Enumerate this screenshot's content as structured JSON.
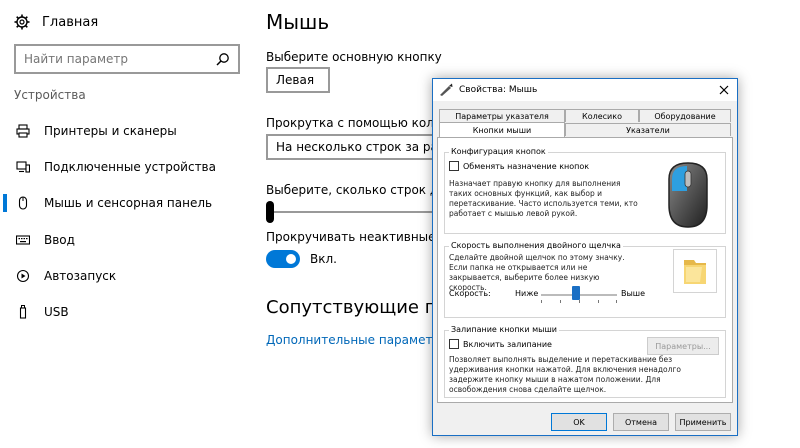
{
  "sidebar": {
    "home_label": "Главная",
    "search_placeholder": "Найти параметр",
    "section_title": "Устройства",
    "items": [
      {
        "label": "Принтеры и сканеры",
        "icon": "printer-icon"
      },
      {
        "label": "Подключенные устройства",
        "icon": "devices-icon"
      },
      {
        "label": "Мышь и сенсорная панель",
        "icon": "mouse-icon"
      },
      {
        "label": "Ввод",
        "icon": "keyboard-icon"
      },
      {
        "label": "Автозапуск",
        "icon": "autoplay-icon"
      },
      {
        "label": "USB",
        "icon": "usb-icon"
      }
    ],
    "active_item": "Мышь и сенсорная панель"
  },
  "main": {
    "title": "Мышь",
    "primary_button_label": "Выберите основную кнопку",
    "primary_button_value": "Левая",
    "scroll_label": "Прокрутка с помощью колесика",
    "scroll_value": "На несколько строк за раз",
    "lines_label": "Выберите, сколько строк должно",
    "inactive_scroll_label": "Прокручивать неактивные окна",
    "inactive_scroll_value": "Вкл.",
    "related_title": "Сопутствующие параметры",
    "related_link": "Дополнительные параметры мыши"
  },
  "dialog": {
    "title": "Свойства: Мышь",
    "tabs_back": [
      "Параметры указателя",
      "Колесико",
      "Оборудование"
    ],
    "tabs_front": [
      "Кнопки мыши",
      "Указатели"
    ],
    "active_tab": "Кнопки мыши",
    "button_config": {
      "title": "Конфигурация кнопок",
      "checkbox": "Обменять назначение кнопок",
      "description": "Назначает правую кнопку для выполнения таких основных функций, как выбор и перетаскивание. Часто используется теми, кто работает с мышью левой рукой."
    },
    "double_click": {
      "title": "Скорость выполнения двойного щелчка",
      "description": "Сделайте двойной щелчок по этому значку. Если папка не открывается или не закрывается, выберите более низкую скорость.",
      "speed_label": "Скорость:",
      "slow_label": "Ниже",
      "fast_label": "Выше"
    },
    "click_lock": {
      "title": "Залипание кнопки мыши",
      "checkbox": "Включить залипание",
      "settings_button": "Параметры...",
      "description": "Позволяет выполнять выделение и перетаскивание без удерживания кнопки нажатой. Для включения ненадолго задержите кнопку мыши в нажатом положении. Для освобождения снова сделайте щелчок."
    },
    "buttons": {
      "ok": "OK",
      "cancel": "Отмена",
      "apply": "Применить"
    }
  },
  "colors": {
    "accent": "#0078d7",
    "link": "#0067b8"
  }
}
